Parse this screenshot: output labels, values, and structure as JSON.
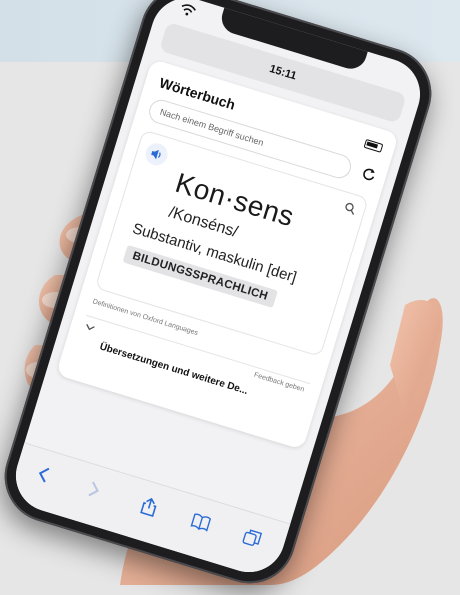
{
  "status_bar": {
    "time": "15:11"
  },
  "card": {
    "title": "Wörterbuch",
    "search": {
      "placeholder": "Nach einem Begriff suchen"
    }
  },
  "entry": {
    "headword": "Kon·sens",
    "phonetic": "/Konséns/",
    "part_of_speech": "Substantiv, maskulin [der]",
    "register": "BILDUNGSSPRACHLICH"
  },
  "footer": {
    "source_note": "Definitionen von Oxford Languages",
    "feedback": "Feedback geben",
    "translations": "Übersetzungen und weitere De..."
  },
  "toolbar": {
    "icons": [
      "back-icon",
      "forward-icon",
      "share-icon",
      "bookmarks-icon",
      "tabs-icon"
    ]
  },
  "colors": {
    "accent": "#2a6bd8",
    "background_band": "#d6e2ea",
    "phone_frame": "#1d1d1f"
  }
}
